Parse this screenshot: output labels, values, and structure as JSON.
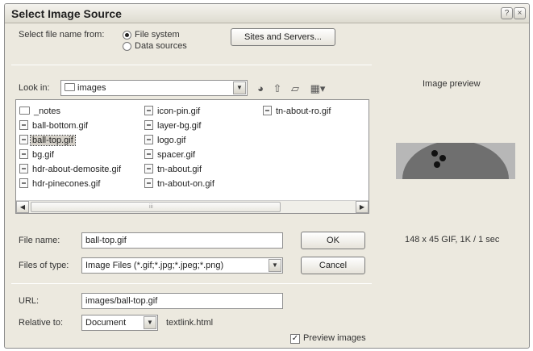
{
  "dialog": {
    "title": "Select Image Source",
    "help_icon": "?",
    "close_icon": "×"
  },
  "source": {
    "label": "Select file name from:",
    "options": [
      "File system",
      "Data sources"
    ],
    "selected": "File system",
    "sites_button": "Sites and Servers..."
  },
  "lookin": {
    "label": "Look in:",
    "value": "images",
    "icons": [
      "back-icon",
      "up-folder-icon",
      "new-folder-icon",
      "view-menu-icon"
    ]
  },
  "files": {
    "col1": [
      "_notes",
      "ball-bottom.gif",
      "ball-top.gif",
      "bg.gif",
      "hdr-about-demosite.gif",
      "hdr-pinecones.gif"
    ],
    "col2": [
      "icon-pin.gif",
      "layer-bg.gif",
      "logo.gif",
      "spacer.gif",
      "tn-about.gif",
      "tn-about-on.gif"
    ],
    "col3": [
      "tn-about-ro.gif"
    ],
    "selected": "ball-top.gif",
    "scroll_marker": "iii"
  },
  "form": {
    "filename_label": "File name:",
    "filename_value": "ball-top.gif",
    "ok_button": "OK",
    "filetype_label": "Files of type:",
    "filetype_value": "Image Files (*.gif;*.jpg;*.jpeg;*.png)",
    "cancel_button": "Cancel",
    "url_label": "URL:",
    "url_value": "images/ball-top.gif",
    "relative_label": "Relative to:",
    "relative_value": "Document",
    "relative_file": "textlink.html",
    "preview_checkbox_label": "Preview images",
    "preview_checked": true
  },
  "preview": {
    "title": "Image preview",
    "info": "148 x 45 GIF, 1K / 1 sec",
    "colors": {
      "background": "#b7b7b7",
      "ball": "#6f6f6f",
      "holes": "#111111"
    }
  }
}
